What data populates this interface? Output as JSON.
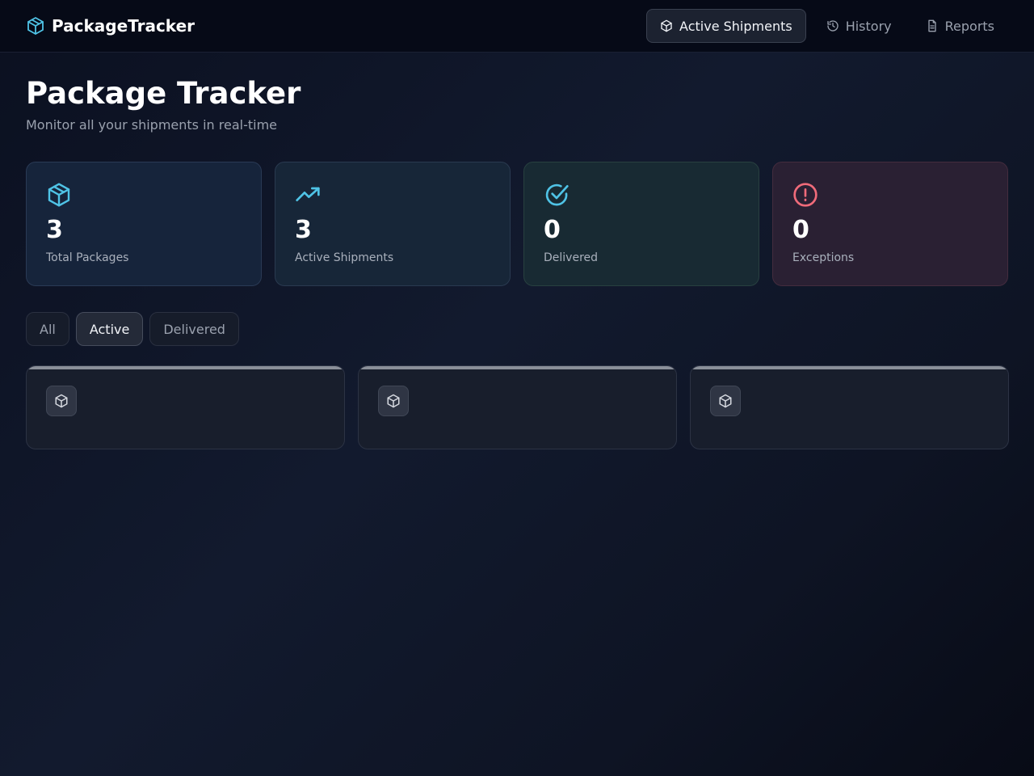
{
  "app": {
    "brand_name": "PackageTracker",
    "brand_icon": "package-icon",
    "accent_color": "#4fc3e6"
  },
  "nav": {
    "items": [
      {
        "label": "Active Shipments",
        "icon": "package-icon",
        "active": true
      },
      {
        "label": "History",
        "icon": "history-icon",
        "active": false
      },
      {
        "label": "Reports",
        "icon": "document-icon",
        "active": false
      }
    ]
  },
  "header": {
    "title": "Package Tracker",
    "subtitle": "Monitor all your shipments in real-time"
  },
  "stats": [
    {
      "value": "3",
      "label": "Total Packages",
      "icon": "package-icon",
      "color": "#4fc3e6"
    },
    {
      "value": "3",
      "label": "Active Shipments",
      "icon": "trending-up-icon",
      "color": "#4fc3e6"
    },
    {
      "value": "0",
      "label": "Delivered",
      "icon": "check-circle-icon",
      "color": "#4fc3e6"
    },
    {
      "value": "0",
      "label": "Exceptions",
      "icon": "alert-circle-icon",
      "color": "#f06b7a"
    }
  ],
  "filters": {
    "items": [
      {
        "label": "All",
        "active": false
      },
      {
        "label": "Active",
        "active": true
      },
      {
        "label": "Delivered",
        "active": false
      }
    ]
  },
  "packages": [
    {
      "icon": "package-icon"
    },
    {
      "icon": "package-icon"
    },
    {
      "icon": "package-icon"
    }
  ]
}
